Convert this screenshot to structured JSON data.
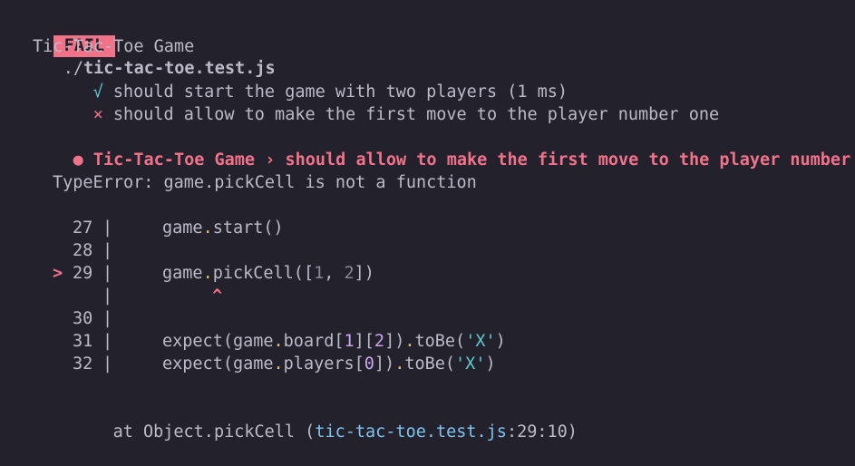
{
  "header": {
    "status_badge": "FAIL",
    "file_dir": "./",
    "file_name": "tic-tac-toe.test.js"
  },
  "suite": {
    "name": "Tic-Tac-Toe Game",
    "tests": [
      {
        "icon": "√",
        "title": "should start the game with two players (1 ms)",
        "status": "pass"
      },
      {
        "icon": "×",
        "title": "should allow to make the first move to the player number one",
        "status": "fail"
      }
    ]
  },
  "failure": {
    "bullet": "●",
    "suite": "Tic-Tac-Toe Game",
    "separator": "›",
    "test": "should allow to make the first move to the player number one",
    "error": "TypeError: game.pickCell is not a function"
  },
  "code_frame": [
    {
      "marker": "",
      "line": "27",
      "code": "game.start()"
    },
    {
      "marker": "",
      "line": "28",
      "code": ""
    },
    {
      "marker": ">",
      "line": "29",
      "code": "game.pickCell([1, 2])"
    },
    {
      "marker": "",
      "line": "",
      "code": "^"
    },
    {
      "marker": "",
      "line": "30",
      "code": ""
    },
    {
      "marker": "",
      "line": "31",
      "code": "expect(game.board[1][2]).toBe('X')"
    },
    {
      "marker": "",
      "line": "32",
      "code": "expect(game.players[0]).toBe('X')"
    }
  ],
  "stack": {
    "prefix": "at Object.pickCell (",
    "file": "tic-tac-toe.test.js",
    "location": ":29:10",
    "suffix": ")"
  },
  "colors": {
    "background": "#23222c",
    "text": "#bdbac8",
    "fail": "#f2728a",
    "pass": "#5ec9cf",
    "link": "#7ec3f0",
    "number": "#c9a6f0",
    "operator": "#e6bd7a"
  }
}
